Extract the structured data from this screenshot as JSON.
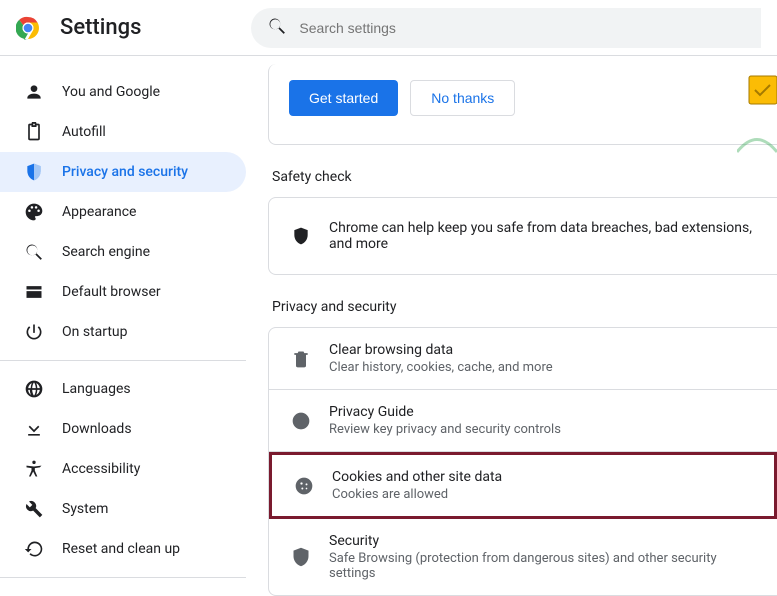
{
  "header": {
    "title": "Settings",
    "searchPlaceholder": "Search settings"
  },
  "sidebar": {
    "items": [
      {
        "label": "You and Google"
      },
      {
        "label": "Autofill"
      },
      {
        "label": "Privacy and security"
      },
      {
        "label": "Appearance"
      },
      {
        "label": "Search engine"
      },
      {
        "label": "Default browser"
      },
      {
        "label": "On startup"
      }
    ],
    "advanced": [
      {
        "label": "Languages"
      },
      {
        "label": "Downloads"
      },
      {
        "label": "Accessibility"
      },
      {
        "label": "System"
      },
      {
        "label": "Reset and clean up"
      }
    ]
  },
  "promo": {
    "primary": "Get started",
    "secondary": "No thanks"
  },
  "safety": {
    "title": "Safety check",
    "text": "Chrome can help keep you safe from data breaches, bad extensions, and more"
  },
  "privacy": {
    "title": "Privacy and security",
    "items": [
      {
        "title": "Clear browsing data",
        "subtitle": "Clear history, cookies, cache, and more"
      },
      {
        "title": "Privacy Guide",
        "subtitle": "Review key privacy and security controls"
      },
      {
        "title": "Cookies and other site data",
        "subtitle": "Cookies are allowed"
      },
      {
        "title": "Security",
        "subtitle": "Safe Browsing (protection from dangerous sites) and other security settings"
      }
    ]
  }
}
